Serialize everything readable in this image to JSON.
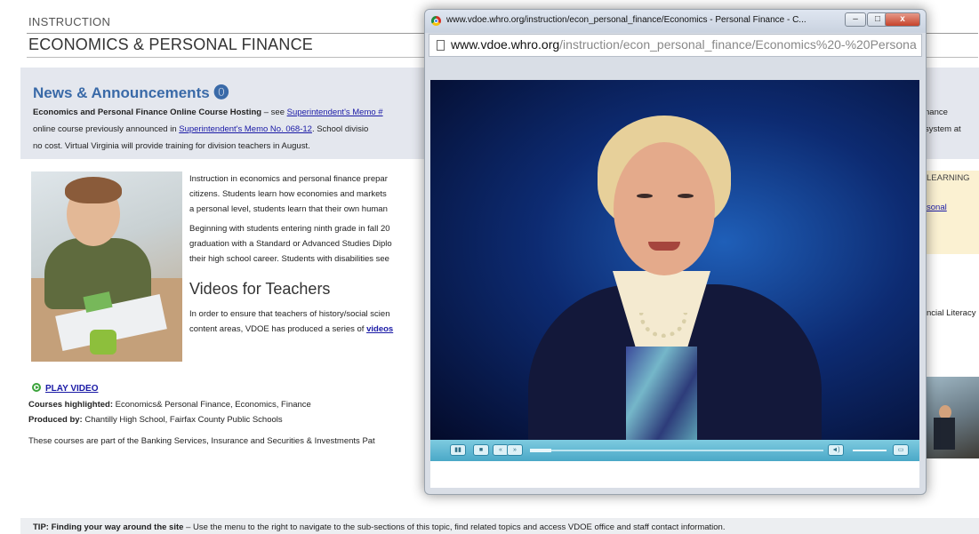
{
  "page": {
    "section": "INSTRUCTION",
    "title": "ECONOMICS & PERSONAL FINANCE"
  },
  "news": {
    "title": "News & Announcements ⓿",
    "line1_bold": "Economics and Personal Finance Online Course Hosting",
    "line1_rest": " – see ",
    "memo_link": "Superintendent's Memo #",
    "line2_pre": "online course previously announced in ",
    "memo_link2": "Superintendent's Memo No. 068-12",
    "line2_post": ". School divisio",
    "line3": "no cost. Virtual Virginia will provide training for division teachers in August.",
    "right1": "nance",
    "right2": "system at"
  },
  "body": {
    "p1": [
      "Instruction in economics and personal finance prepar",
      "citizens. Students learn how economies and markets",
      "a personal level, students learn that their own human"
    ],
    "p2": [
      "Beginning with students entering ninth grade in fall 20",
      "graduation with a Standard or Advanced Studies Diplo",
      "their high school career. Students with disabilities see"
    ],
    "videos_title": "Videos for Teachers",
    "p3_line1": "In order to ensure that teachers of history/social scien",
    "p3_line2_pre": "content areas, VDOE has produced a series of ",
    "p3_link": " videos"
  },
  "right": {
    "learning": "LEARNING",
    "learning_link": "sonal",
    "literacy": "ncial Literacy"
  },
  "video_section": {
    "play": "PLAY VIDEO",
    "courses_label": "Courses highlighted:",
    "courses": " Economics& Personal Finance, Economics, Finance",
    "produced_label": "Produced by:",
    "produced": " Chantilly High School, Fairfax County Public Schools",
    "banking": "These courses are part of the Banking Services, Insurance and Securities & Investments Pat"
  },
  "tip": {
    "label": "TIP: Finding your way around the site",
    "text": " – Use the menu to the right to navigate to the sub-sections of this topic, find related topics and access VDOE office and staff contact information."
  },
  "popup": {
    "title": "www.vdoe.whro.org/instruction/econ_personal_finance/Economics - Personal Finance - C...",
    "url_domain": "www.vdoe.whro.org",
    "url_path": "/instruction/econ_personal_finance/Economics%20-%20Persona",
    "controls": {
      "play": "▮▮",
      "stop": "■",
      "rewind": "«",
      "forward": "»",
      "volume": "◄)",
      "fullscreen": "▭"
    },
    "window_buttons": {
      "minimize": "–",
      "maximize": "□",
      "close": "x"
    }
  }
}
